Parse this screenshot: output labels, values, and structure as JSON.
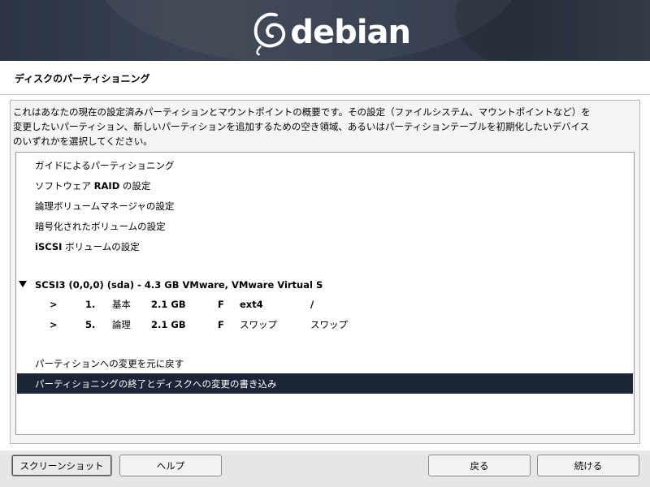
{
  "banner": {
    "logo_text": "debian"
  },
  "page": {
    "title": "ディスクのパーティショニング",
    "description_lines": [
      "これはあなたの現在の設定済みパーティションとマウントポイントの概要です。その設定（ファイルシステム、マウントポイントなど）を",
      "変更したいパーティション、新しいパーティションを追加するための空き領域、あるいはパーティションテーブルを初期化したいデバイス",
      "のいずれかを選択してください。"
    ]
  },
  "list": {
    "guided": "ガイドによるパーティショニング",
    "raid_prefix": "ソフトウェア ",
    "raid_bold": "RAID",
    "raid_suffix": " の設定",
    "lvm": "論理ボリュームマネージャの設定",
    "crypto": "暗号化されたボリュームの設定",
    "iscsi_bold": "iSCSI",
    "iscsi_suffix": " ボリュームの設定",
    "disk": "SCSI3 (0,0,0) (sda) - 4.3 GB VMware, VMware Virtual S",
    "partitions": [
      {
        "arrow": ">",
        "number": "1.",
        "type": "基本",
        "size": "2.1 GB",
        "flag": "F",
        "fs": "ext4",
        "mount": "/"
      },
      {
        "arrow": ">",
        "number": "5.",
        "type": "論理",
        "size": "2.1 GB",
        "flag": "F",
        "fs": "スワップ",
        "mount": "スワップ"
      }
    ],
    "undo": "パーティションへの変更を元に戻す",
    "finish": "パーティショニングの終了とディスクへの変更の書き込み"
  },
  "buttons": {
    "screenshot": "スクリーンショット",
    "help": "ヘルプ",
    "back": "戻る",
    "continue": "続ける"
  },
  "colors": {
    "banner": "#2e3440",
    "selection": "#1c2536"
  }
}
